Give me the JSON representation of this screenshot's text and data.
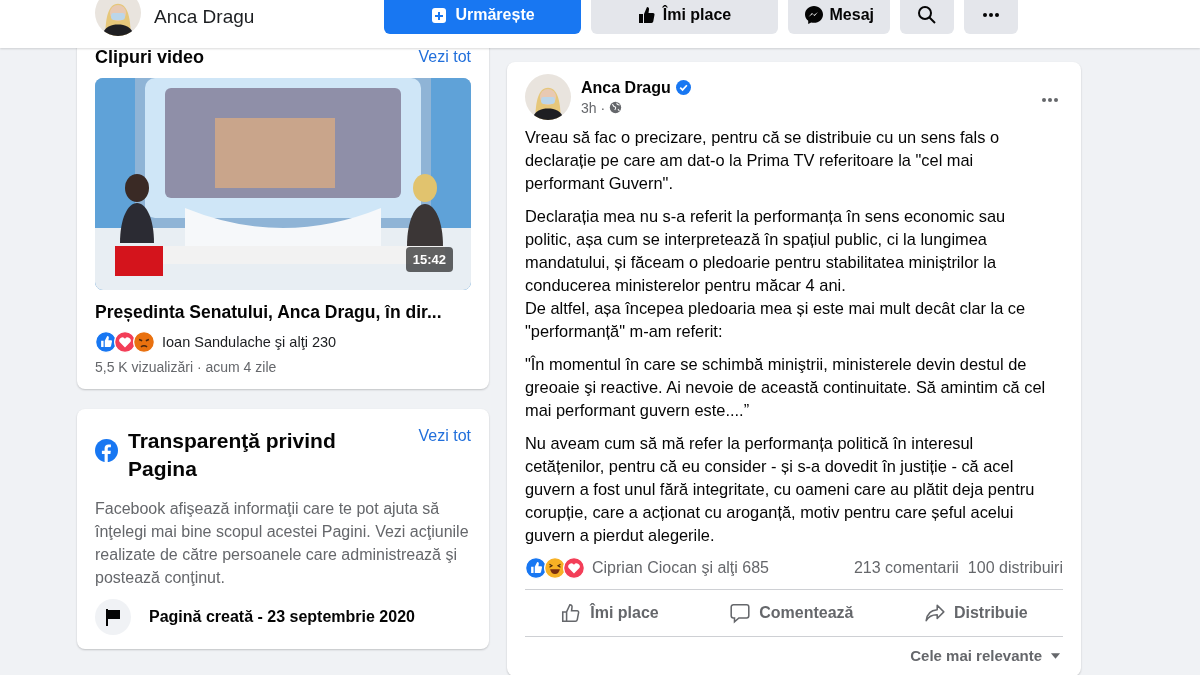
{
  "header": {
    "name": "Anca Dragu",
    "buttons": [
      {
        "kind": "follow",
        "label": "Urmărește"
      },
      {
        "kind": "like",
        "label": "Îmi place"
      },
      {
        "kind": "message",
        "label": "Mesaj"
      },
      {
        "kind": "search"
      },
      {
        "kind": "more"
      }
    ]
  },
  "videos": {
    "title": "Clipuri video",
    "see_all": "Vezi tot",
    "video": {
      "kind": "picture",
      "duration": "15:42",
      "title": "Președinta Senatului, Anca Dragu, în dir...",
      "reactions": [
        {
          "kind": "like"
        },
        {
          "kind": "love"
        },
        {
          "kind": "angry"
        }
      ],
      "reactors": "Ioan Sandulache şi alţi 230",
      "meta": "5,5 K vizualizări · acum 4 zile"
    }
  },
  "transparency": {
    "title": "Transparenţă privind Pagina",
    "see_all": "Vezi tot",
    "text": "Facebook afişează informaţii care te pot ajuta să înţelegi mai bine scopul acestei Pagini. Vezi acţiunile realizate de către persoanele care administrează şi postează conţinut.",
    "created": "Pagină creată - 23 septembrie 2020"
  },
  "post": {
    "author": "Anca Dragu",
    "verified": true,
    "time": "3h",
    "separator": "·",
    "paragraphs": [
      "Vreau să fac o precizare, pentru că se distribuie cu un sens fals o declarație pe care am dat-o la Prima TV referitoare la \"cel mai performant Guvern\".",
      "Declarația mea nu s-a referit la performanța în sens economic sau politic, așa cum se interpretează în spațiul public, ci la lungimea mandatului, și făceam o pledoarie pentru stabilitatea miniștrilor la conducerea ministerelor pentru măcar 4 ani.\nDe altfel, așa începea pledoaria mea și este mai mult decât clar la ce \"performanță\" m-am referit:",
      "\"În momentul în care se schimbă miniştrii, ministerele devin destul de greoaie şi reactive. Ai nevoie de această continuitate. Să amintim că cel mai performant guvern este....”",
      "Nu aveam cum să mă refer la performanța politică în interesul cetățenilor, pentru că eu consider - și s-a dovedit în justiție - că acel guvern a fost unul fără integritate, cu oameni care au plătit deja pentru corupție, care a acționat cu aroganță, motiv pentru care șeful acelui guvern a pierdut alegerile."
    ],
    "reactions": [
      {
        "kind": "like"
      },
      {
        "kind": "haha"
      },
      {
        "kind": "love"
      }
    ],
    "reactors": "Ciprian Ciocan şi alţi 685",
    "comments": "213 comentarii",
    "shares": "100 distribuiri",
    "actions": [
      {
        "kind": "like",
        "label": "Îmi place"
      },
      {
        "kind": "comment",
        "label": "Comentează"
      },
      {
        "kind": "share",
        "label": "Distribuie"
      }
    ],
    "sort": "Cele mai relevante"
  }
}
